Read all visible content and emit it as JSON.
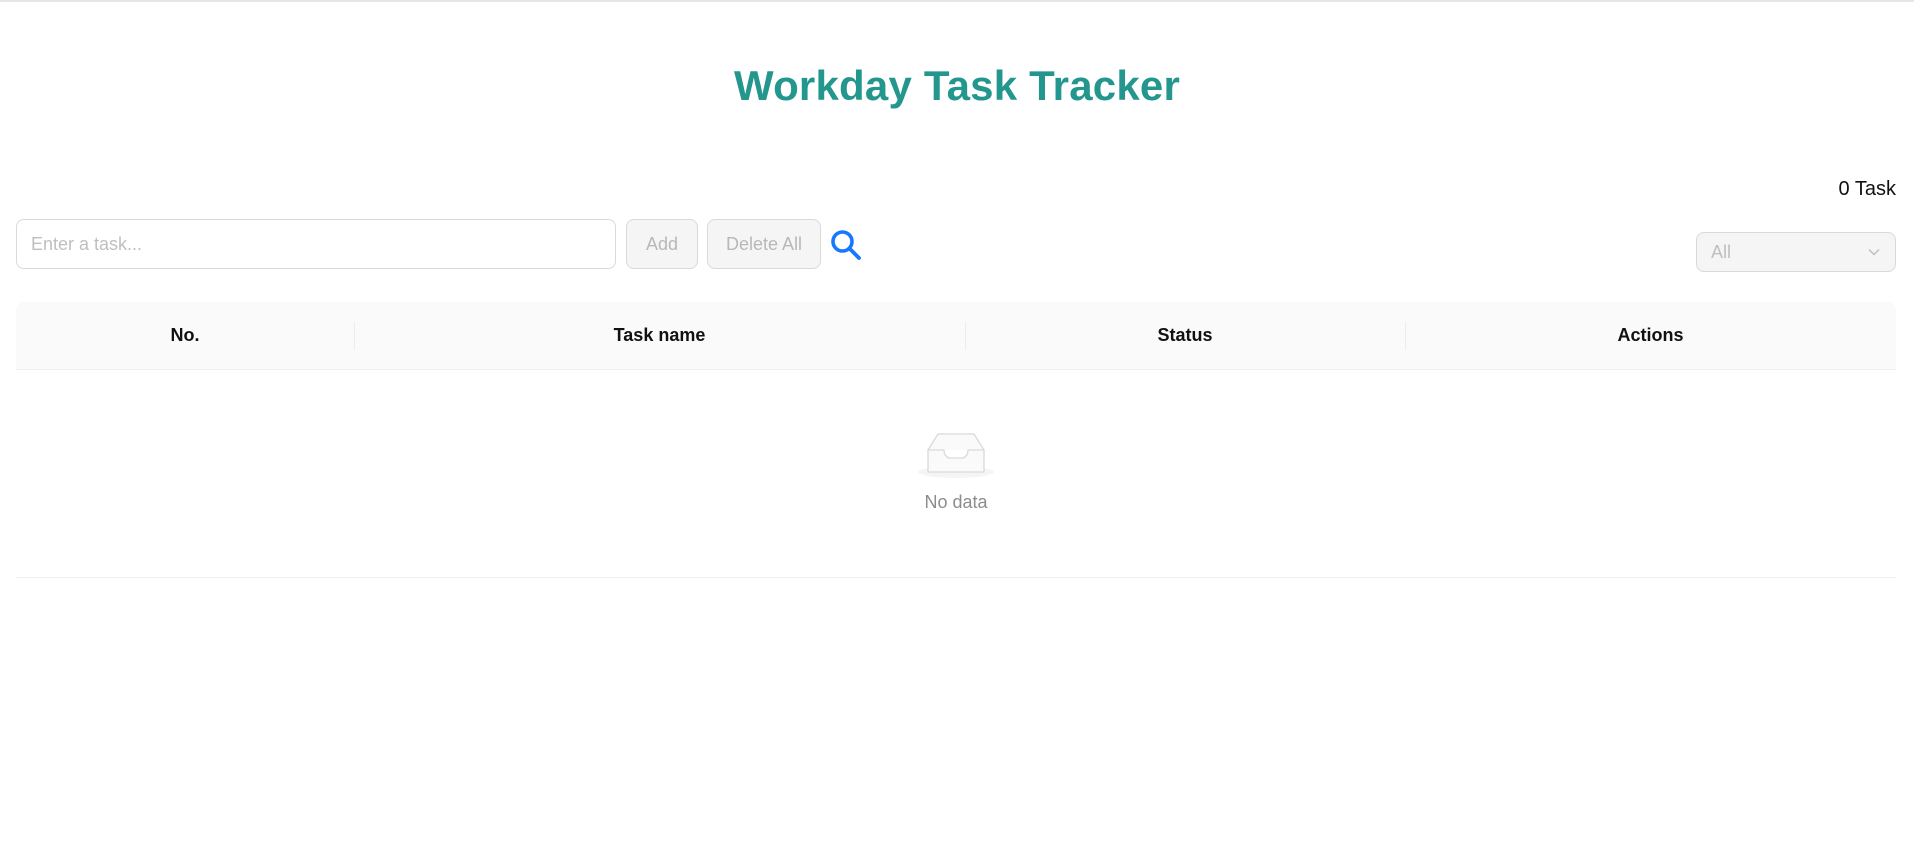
{
  "header": {
    "title": "Workday Task Tracker"
  },
  "summary": {
    "task_count": "0 Task"
  },
  "toolbar": {
    "input_placeholder": "Enter a task...",
    "input_value": "",
    "add_label": "Add",
    "delete_all_label": "Delete All",
    "search_icon": "search-icon",
    "filter_selected": "All"
  },
  "table": {
    "columns": [
      "No.",
      "Task name",
      "Status",
      "Actions"
    ],
    "rows": [],
    "empty_text": "No data"
  },
  "colors": {
    "title": "#23968e",
    "search_icon": "#1677ff",
    "disabled_bg": "#f5f5f5",
    "header_bg": "#fafafa"
  }
}
